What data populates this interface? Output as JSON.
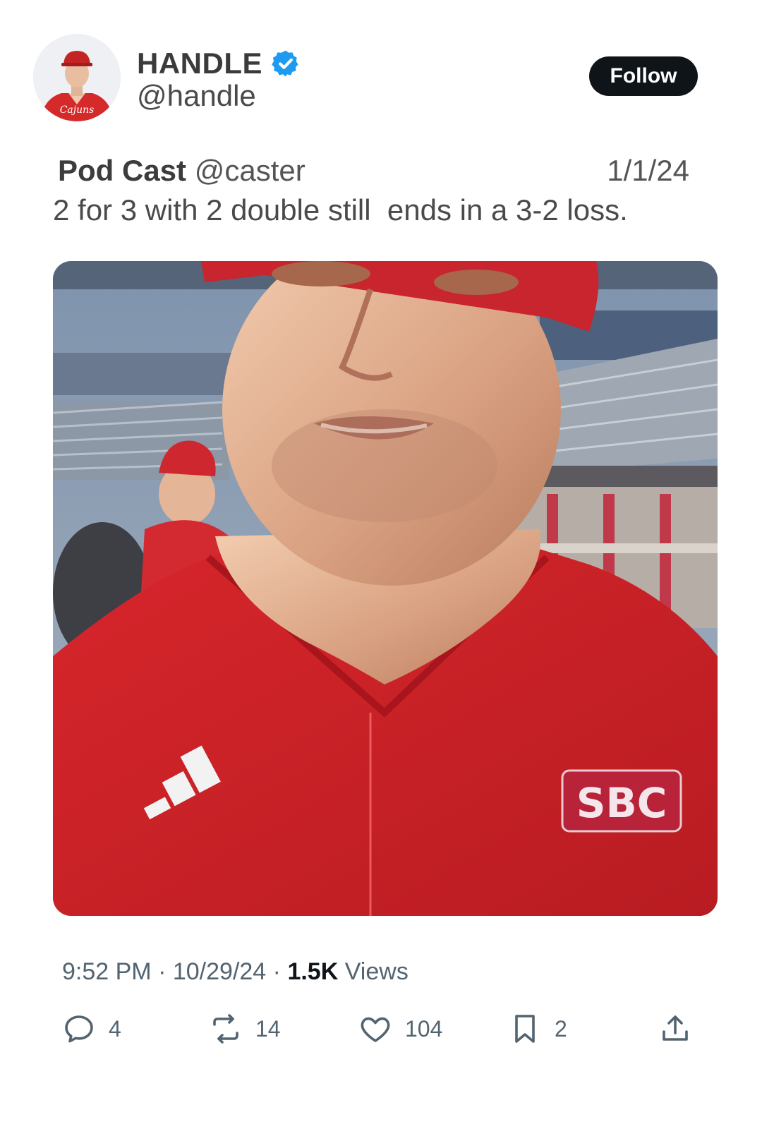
{
  "author": {
    "display_name": "HANDLE",
    "handle": "@handle",
    "verified": true,
    "follow_label": "Follow"
  },
  "quoted": {
    "name": "Pod Cast",
    "handle": "@caster",
    "date": "1/1/24"
  },
  "tweet": {
    "text": "2 for 3 with 2 double still  ends in a 3-2 loss."
  },
  "media": {
    "jersey_patch_text": "SBC"
  },
  "meta": {
    "time": "9:52 PM",
    "date": "10/29/24",
    "views_count": "1.5K",
    "views_label": "Views"
  },
  "actions": {
    "replies": "4",
    "reposts": "14",
    "likes": "104",
    "bookmarks": "2"
  },
  "colors": {
    "verified_blue": "#1d9bf0",
    "button_black": "#0f1419",
    "meta_gray": "#536471",
    "jersey_red": "#d42a2a"
  }
}
